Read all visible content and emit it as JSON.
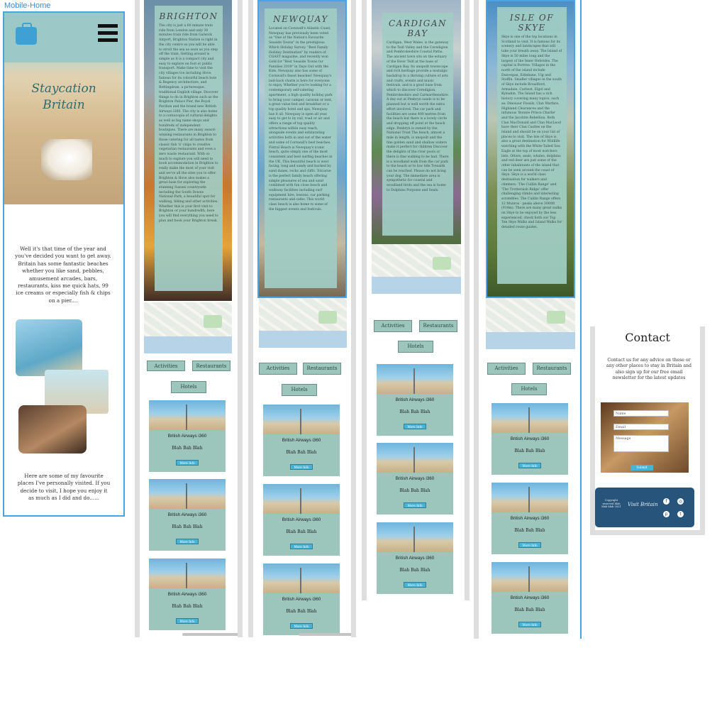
{
  "frame_title": "Mobile-Home",
  "home": {
    "hero_title_line1": "Staycation",
    "hero_title_line2": "Britain",
    "intro": "Well it's that time of the year and you've decided you want to get away. Britain has some fantastic beaches whether you like sand, pebbles, amusement arcades, bars, restaurants, kiss me quick hats, 99 ice creams or especially fish & chips on a pier....",
    "favourites": "Here are some of my favourite places I've personally visited. If you decide to visit, I hope you enjoy it as much as I did and do......"
  },
  "destinations": [
    {
      "title": "BRIGHTON",
      "body": "The city is just a 60 minute train ride from London and only 30 minutes train ride from Gatwick Airport, Brighton Station is right in the city centre so you will be able to stroll the sea as soon as you step off the train. Getting around is simple as it is a compact city and easy to explore on foot or public transport. Make time to visit the city villages too including Hove, famous for its colourful beach huts & Regency architecture, and Rottingdean, a picturesque, traditional English village. Discover things to do in Brighton such as the Brighton Palace Pier, the Royal Pavilion and the brand new British Airways i360. The city is also home to a cornucopia of cultural delights as well as big name shops and hundreds of independent boutiques. There are many award-winning restaurants in Brighton to those catering for all tastes from classic fish 'n' chips to creative vegetarian restaurants and even a zero waste restaurant. With so much to explore you will need to book accommodation in Brighton to really make the most of your visit and we've all the sites you to offer. Brighton & Hove also makes a great base for exploring the stunning Sussex countryside including the South Downs National Park, a beautiful spot for walking, hiking and other activities. Whether this is your first visit to Brighton or your hundredth, here you will find everything you need to plan and book your Brighton break."
    },
    {
      "title": "NEWQUAY",
      "body": "Located on Cornwall's Atlantic Coast, Newquay has previously been voted as \"One of the Nation's Favourite Seaside Towns\" in the prestigious Which Holiday Survey. \"Best Family Holiday Destination\" by readers of COAST magazine, and recently won Gold for \"Best Seaside Towns for Families 2019\" in Days Out with the Kids. Newquay also has some of Cornwall's finest beaches! Newquay's laid-back charm is here for everyone to enjoy. Whether you're looking for a contemporary self-catering apartment, a high quality holiday park to bring your camper, caravan or tent, a great value bed and breakfast or a top quality hotel and spa, Newquay has it all. Newquay is open all year, easy to get to by rail, road or air and offers a range of top quality attractions within easy reach, alongside events and exhilarating activities both in and out of the water and some of Cornwall's best beaches. Fistral Beach is Newquay's iconic beach, quite simply one of the most consistent and best surfing beaches in the UK. This beautiful beach is west facing, long and sandy and backed by sand dunes, rocks and cliffs. Tolcarne is the perfect family beach offering simple pleasures of sea and sand combined with fun close beach and walkway facilities including surf equipment hire, lessons, car parking, restaurants and cafes. This world class beach is also home to some of the biggest events and festivals."
    },
    {
      "title": "CARDIGAN BAY",
      "body": "Cardigan, West Wales, is the gateway to the Teifi Valley and the Ceredigion and Pembrokeshire Coastal Paths. The ancient town sits on the estuary of the River Teifi at the base of Cardigan Bay. Its unspoilt townscape and rich heritage provide a nostalgic backdrop to a thriving culture of arts and crafts, events and music festivals, and is a good base from which to discover Ceredigion, Pembrokeshire and Carmarthenshire. A day out at Penbryn sands is to be planned but is well worth the extra effort involved. The car park and facilities are some 400 metres from the beach but there is a lovely circle and dropping off point at the beach edge. Penbryn is owned by the National Trust The beach, almost a mile in length, is unspoilt and the fine golden sand and shallow waters make it perfect for children Discover the delights of the river pools or there is fine walking to be had. There is a woodland walk from the car park to the beach or to low tide Tresaith can be reached. Please do not bring your dog. The immediate area is sympathetic for coastal and woodland birds and the sea is home to Dolphins Porpoise and Seals."
    },
    {
      "title": "ISLE OF SKYE",
      "body": "Skye is one of the top locations in Scotland to visit. It is famous for its scenery and landscapes that will take your breath away. The Island of Skye is 50 miles long and the largest of the Inner Hebrides. The capital is Portree. Villages in the north of the island include Dunvegan, Edinbane, Uig and Staffin. Smaller villages in the south of Skye include Broadford, Armadale, Carbost, Elgol and Kyleakin. The Island has a rich history covering many topics, such as: Dinosaur Fossils, Clan Warfare, Highland Clearances and the infamous 'Bonnie Prince Charlie' and the Jacobite Rebellion. Both Clan MacDonald and Clan MacLeod have their Clan Castles on the Island and should be on your list of places to visit. The Isle of Skye is also a great destination for Wildlife watching with the White-Tailed Sea Eagle at the top of most watchers lists. Otters, seals, whales, dolphins and red deer are just some of the other inhabitants of the island that can be seen around the coast of Skye. Skye is a world class destination for walkers and climbers. 'The Cuillin Range' and 'The Trotternish Ridge' offer challenging climbs and interesting scrambles. The Cuillin Range offers 12 Munros - peaks above 3000ft (914m). There are many great walks on Skye to be enjoyed by the less experienced, check both our Top Ten Skye Walks and Island Walks for detailed route guides."
    }
  ],
  "buttons": {
    "activities": "Activities",
    "restaurants": "Restaurants",
    "hotels": "Hotels"
  },
  "card": {
    "name": "British Airways i360",
    "blah": "Blah  Bah Blah",
    "more": "More Info"
  },
  "contact": {
    "title": "Contact",
    "text": "Contact us for any advice on these or any other places to stay in Britain and also sign up for our free email newsletter for the latest updates",
    "name_label": "Name",
    "email_label": "Email",
    "message_label": "Message",
    "submit": "Submit",
    "footer_copy": "Copyright reserved blah blah blah 2021",
    "footer_brand": "Visit Britain"
  },
  "colors": {
    "accent_teal": "#9cc6bb",
    "info_blue": "#47b4d6",
    "footer_navy": "#27547a",
    "selection": "#4ba3e3"
  }
}
